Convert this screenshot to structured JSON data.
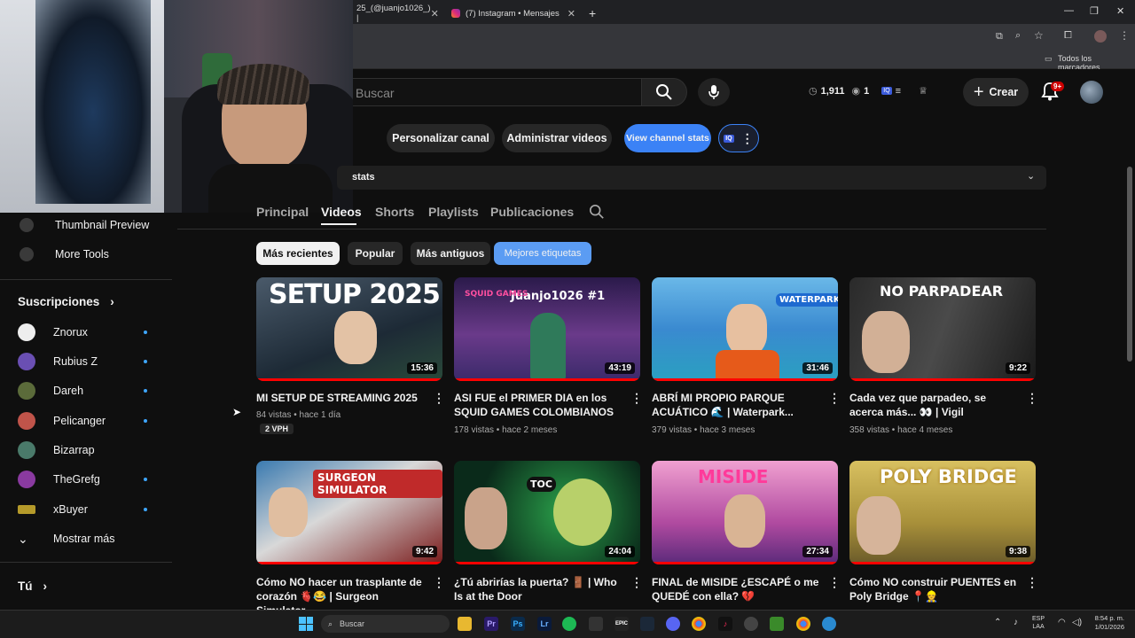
{
  "browser": {
    "tabs": [
      {
        "label": "25_(@juanjo1026_) |"
      },
      {
        "label": "(7) Instagram • Mensajes"
      }
    ],
    "bookmarks_label": "Todos los marcadores",
    "new_tab_glyph": "+"
  },
  "header": {
    "search_placeholder": "Buscar",
    "stats": {
      "views": "1,911",
      "eye": "1"
    },
    "create_label": "Crear",
    "notif_badge": "9+"
  },
  "channel": {
    "buttons": {
      "customize": "Personalizar canal",
      "manage": "Administrar videos",
      "stats": "View channel stats"
    },
    "stats_bar_label": "stats",
    "tabs": [
      "Principal",
      "Videos",
      "Shorts",
      "Playlists",
      "Publicaciones"
    ],
    "chips": [
      "Más recientes",
      "Popular",
      "Más antiguos",
      "Mejores etiquetas"
    ]
  },
  "sidebar": {
    "tools": [
      "Thumbnail Preview",
      "More Tools"
    ],
    "subs_heading": "Suscripciones",
    "subs": [
      "Znorux",
      "Rubius Z",
      "Dareh",
      "Pelicanger",
      "Bizarrap",
      "TheGrefg",
      "xBuyer"
    ],
    "show_more": "Mostrar más",
    "you_heading": "Tú"
  },
  "videos": [
    {
      "title": "MI SETUP DE STREAMING 2025",
      "meta": "84 vistas • hace 1 día",
      "badge": "2 VPH",
      "duration": "15:36",
      "thumb_text": "SETUP 2025",
      "progress": 1.0
    },
    {
      "title": "ASI FUE el PRIMER DIA en los SQUID GAMES COLOMBIANOS",
      "meta": "178 vistas • hace 2 meses",
      "duration": "43:19",
      "thumb_text": "Juanjo1026 #1",
      "thumb_subtext": "SQUID GAMES",
      "progress": 1.0
    },
    {
      "title": "ABRÍ MI PROPIO PARQUE ACUÁTICO 🌊 | Waterpark...",
      "meta": "379 vistas • hace 3 meses",
      "duration": "31:46",
      "thumb_text": "WATERPARK",
      "progress": 1.0
    },
    {
      "title": "Cada vez que parpadeo, se acerca más... 👀 | Vigil",
      "meta": "358 vistas • hace 4 meses",
      "duration": "9:22",
      "thumb_text": "NO PARPADEAR",
      "progress": 1.0
    },
    {
      "title": "Cómo NO hacer un trasplante de corazón 🫀😂 | Surgeon Simulator",
      "meta": "",
      "duration": "9:42",
      "thumb_text": "SURGEON SIMULATOR",
      "progress": 1.0
    },
    {
      "title": "¿Tú abrirías la puerta? 🚪 | Who Is at the Door",
      "meta": "",
      "duration": "24:04",
      "thumb_text": "TOC",
      "progress": 1.0
    },
    {
      "title": "FINAL de MISIDE ¿ESCAPÉ o me QUEDÉ con ella? 💔",
      "meta": "",
      "duration": "27:34",
      "thumb_text": "MISIDE",
      "progress": 1.0
    },
    {
      "title": "Cómo NO construir PUENTES en Poly Bridge 📍👷",
      "meta": "",
      "duration": "9:38",
      "thumb_text": "POLY BRIDGE",
      "progress": 1.0
    }
  ],
  "taskbar": {
    "search_placeholder": "Buscar",
    "lang": "ESP",
    "lang2": "LAA",
    "time": "8:54 p. m.",
    "date": "1/01/2026"
  },
  "colors": {
    "accent_blue": "#3ea6ff",
    "chip_active": "#5b9cf3",
    "stats_btn": "#3b82f6",
    "red": "#ff0000"
  }
}
